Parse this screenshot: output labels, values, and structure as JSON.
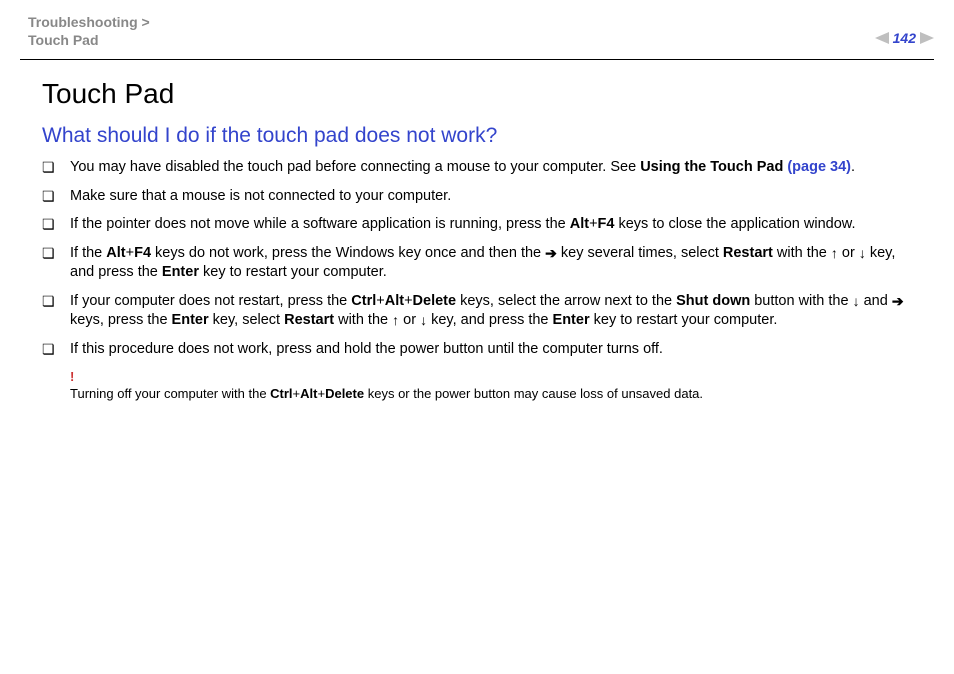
{
  "breadcrumb": {
    "section": "Troubleshooting",
    "sep": ">",
    "page": "Touch Pad"
  },
  "page_number": "142",
  "title": "Touch Pad",
  "question": "What should I do if the touch pad does not work?",
  "items": {
    "i0": {
      "p1": "You may have disabled the touch pad before connecting a mouse to your computer. See ",
      "b1": "Using the Touch Pad ",
      "link": "(page 34)",
      "p2": "."
    },
    "i1": {
      "text": "Make sure that a mouse is not connected to your computer."
    },
    "i2": {
      "p1": "If the pointer does not move while a software application is running, press the ",
      "b1": "Alt",
      "plus1": "+",
      "b2": "F4",
      "p2": " keys to close the application window."
    },
    "i3": {
      "p1": "If the ",
      "b1": "Alt",
      "plus1": "+",
      "b2": "F4",
      "p2": " keys do not work, press the Windows key once and then the ",
      "p3": " key several times, select ",
      "b3": "Restart",
      "p4": " with the ",
      "p5": " or ",
      "p6": " key, and press the ",
      "b4": "Enter",
      "p7": " key to restart your computer."
    },
    "i4": {
      "p1": "If your computer does not restart, press the ",
      "b1": "Ctrl",
      "plus1": "+",
      "b2": "Alt",
      "plus2": "+",
      "b3": "Delete",
      "p2": " keys, select the arrow next to the ",
      "b4": "Shut down",
      "p3": " button with the ",
      "p4": " and ",
      "p5": " keys, press the ",
      "b5": "Enter",
      "p6": " key, select ",
      "b6": "Restart",
      "p7": " with the ",
      "p8": " or ",
      "p9": " key, and press the ",
      "b7": "Enter",
      "p10": " key to restart your computer."
    },
    "i5": {
      "text": "If this procedure does not work, press and hold the power button until the computer turns off."
    }
  },
  "note": {
    "bang": "!",
    "p1": "Turning off your computer with the ",
    "b1": "Ctrl",
    "plus1": "+",
    "b2": "Alt",
    "plus2": "+",
    "b3": "Delete",
    "p2": " keys or the power button may cause loss of unsaved data."
  },
  "arrows": {
    "right": "➔",
    "up": "↑",
    "down": "↓"
  }
}
